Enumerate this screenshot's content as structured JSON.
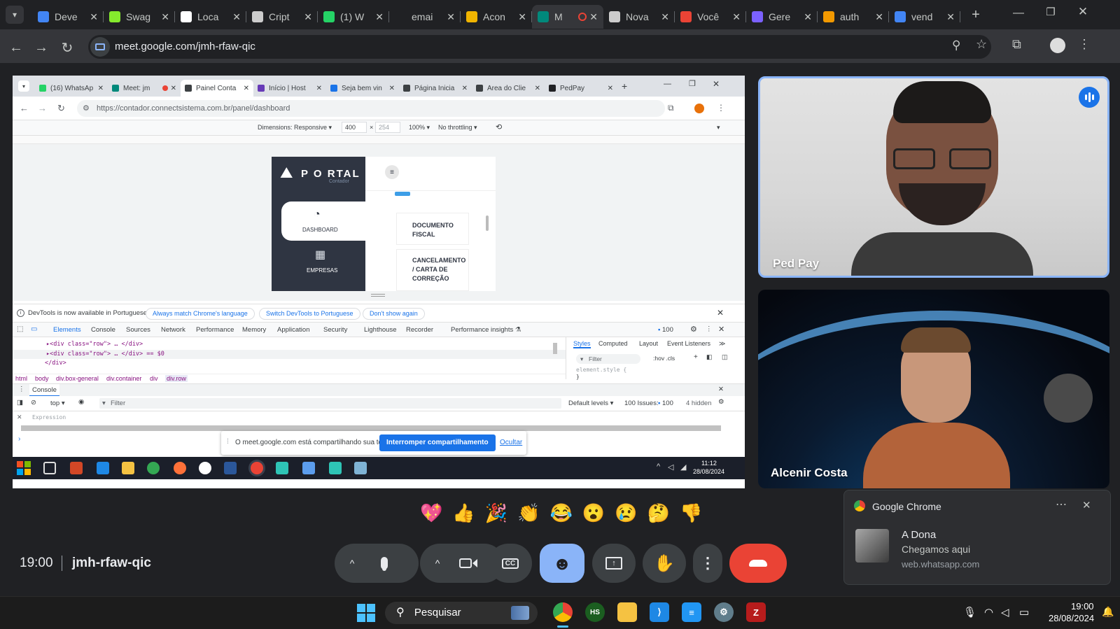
{
  "outer_tabs": [
    {
      "label": "Deve",
      "fav_color": "#4285f4"
    },
    {
      "label": "Swag",
      "fav_color": "#85ea2d"
    },
    {
      "label": "Loca",
      "fav_color": "#ffffff"
    },
    {
      "label": "Cript",
      "fav_color": "#cccccc"
    },
    {
      "label": "(1) W",
      "fav_color": "#25d366"
    },
    {
      "label": "emai",
      "fav_color": "#202124"
    },
    {
      "label": "Acon",
      "fav_color": "#f0b400"
    },
    {
      "label": "M",
      "fav_color": "#00897b"
    },
    {
      "label": "Nova",
      "fav_color": "#cccccc"
    },
    {
      "label": "Você",
      "fav_color": "#ea4335"
    },
    {
      "label": "Gere",
      "fav_color": "#7b61ff"
    },
    {
      "label": "auth",
      "fav_color": "#f29900"
    },
    {
      "label": "vend",
      "fav_color": "#4285f4"
    }
  ],
  "url": "meet.google.com/jmh-rfaw-qic",
  "inner": {
    "tabs": [
      {
        "label": "(16) WhatsAp",
        "fav_color": "#25d366"
      },
      {
        "label": "Meet: jm",
        "fav_color": "#00897b"
      },
      {
        "label": "Painel Conta",
        "fav_color": "#3c4043"
      },
      {
        "label": "Início | Host",
        "fav_color": "#673ab7"
      },
      {
        "label": "Seja bem vin",
        "fav_color": "#1a73e8"
      },
      {
        "label": "Página Inicia",
        "fav_color": "#3c4043"
      },
      {
        "label": "Área do Clie",
        "fav_color": "#3c4043"
      },
      {
        "label": "PedPay",
        "fav_color": "#202124"
      }
    ],
    "url": "https://contador.connectsistema.com.br/panel/dashboard",
    "devbar": {
      "dimensions": "Dimensions: Responsive ▾",
      "width": "400",
      "height": "254",
      "zoom": "100% ▾",
      "throttle": "No throttling ▾"
    },
    "portal": {
      "logo": "P O RTAL",
      "logo_sub": "Contador",
      "dashboard": "DASHBOARD",
      "empresas": "EMPRESAS",
      "doc1": "DOCUMENTO",
      "doc2": "FISCAL",
      "canc1": "CANCELAMENTO",
      "canc2": "/ CARTA DE",
      "canc3": "CORREÇÃO"
    },
    "infobar": {
      "text": "DevTools is now available in Portuguese!",
      "btn1": "Always match Chrome's language",
      "btn2": "Switch DevTools to Portuguese",
      "btn3": "Don't show again"
    },
    "devtools_tabs": [
      "Elements",
      "Console",
      "Sources",
      "Network",
      "Performance",
      "Memory",
      "Application",
      "Security",
      "Lighthouse",
      "Recorder",
      "Performance insights ⚗"
    ],
    "issues_count": "100",
    "code": [
      "▸<div class=\"row\"> … </div>",
      "▸<div class=\"row\"> … </div> == $0",
      "</div>"
    ],
    "crumbs": [
      "html",
      "body",
      "div.box-general",
      "div.container",
      "div",
      "div.row"
    ],
    "styles_tabs": [
      "Styles",
      "Computed",
      "Layout",
      "Event Listeners",
      "≫"
    ],
    "styles_filter": "Filter",
    "styles_hov": ":hov  .cls",
    "style_rule": "element.style {",
    "style_close": "}",
    "console_title": "Console",
    "console": {
      "top": "top ▾",
      "filter": "Filter",
      "levels": "Default levels ▾",
      "issues": "100 Issues:",
      "issues_count": "100",
      "hidden": "4 hidden",
      "expression": "Expression"
    },
    "share": {
      "text": "O meet.google.com está compartilhando sua tela.",
      "stop": "Interromper compartilhamento",
      "hide": "Ocultar"
    },
    "taskbar": {
      "time": "11:12",
      "date": "28/08/2024"
    }
  },
  "participants": [
    {
      "name": "Ped Pay"
    },
    {
      "name": "Alcenir Costa"
    }
  ],
  "notification": {
    "app": "Google Chrome",
    "title": "A Dona",
    "message": "Chegamos aqui",
    "source": "web.whatsapp.com"
  },
  "meeting": {
    "time": "19:00",
    "code": "jmh-rfaw-qic"
  },
  "reactions": [
    "💖",
    "👍",
    "🎉",
    "👏",
    "😂",
    "😮",
    "😢",
    "🤔",
    "👎"
  ],
  "taskbar": {
    "search": "Pesquisar",
    "time": "19:00",
    "date": "28/08/2024"
  },
  "colors": {
    "accent": "#8ab4f8",
    "end_call": "#ea4335",
    "active_ctrl": "#8ab4f8",
    "speaking_border": "#8ab4f8"
  }
}
